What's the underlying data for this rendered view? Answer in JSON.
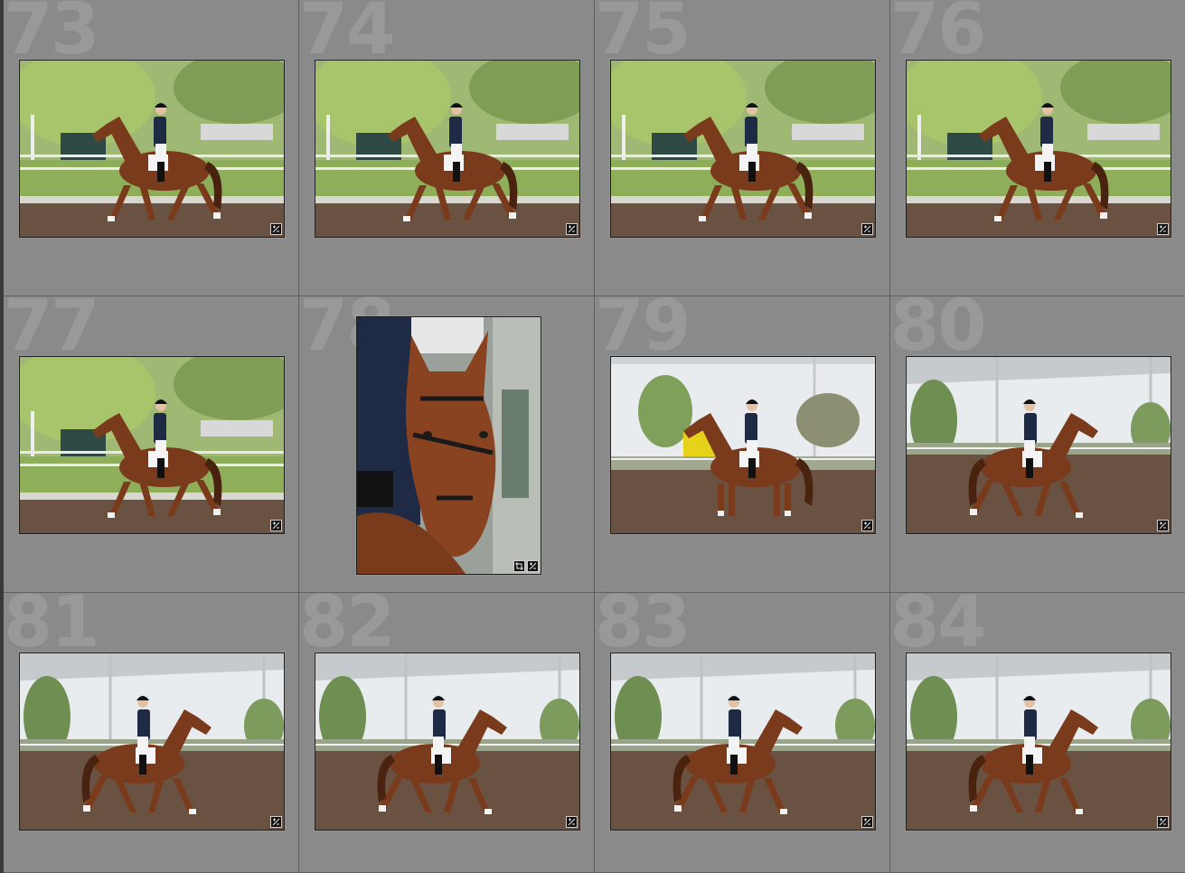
{
  "app": "Photo library grid view",
  "cells": [
    {
      "number": "73",
      "orientation": "landscape",
      "scene": "trees-left",
      "badges": [
        "develop-adjustments-icon"
      ]
    },
    {
      "number": "74",
      "orientation": "landscape",
      "scene": "trees-left",
      "badges": [
        "develop-adjustments-icon"
      ]
    },
    {
      "number": "75",
      "orientation": "landscape",
      "scene": "trees-left",
      "badges": [
        "develop-adjustments-icon"
      ]
    },
    {
      "number": "76",
      "orientation": "landscape",
      "scene": "trees-left",
      "badges": [
        "develop-adjustments-icon"
      ]
    },
    {
      "number": "77",
      "orientation": "landscape",
      "scene": "trees-left",
      "badges": [
        "develop-adjustments-icon"
      ]
    },
    {
      "number": "78",
      "orientation": "portrait",
      "scene": "closeup",
      "badges": [
        "crop-icon",
        "develop-adjustments-icon"
      ]
    },
    {
      "number": "79",
      "orientation": "landscape",
      "scene": "arena-standing",
      "badges": [
        "develop-adjustments-icon"
      ]
    },
    {
      "number": "80",
      "orientation": "landscape",
      "scene": "arena-right",
      "badges": [
        "develop-adjustments-icon"
      ]
    },
    {
      "number": "81",
      "orientation": "landscape",
      "scene": "arena-right",
      "badges": [
        "develop-adjustments-icon"
      ]
    },
    {
      "number": "82",
      "orientation": "landscape",
      "scene": "arena-right",
      "badges": [
        "develop-adjustments-icon"
      ]
    },
    {
      "number": "83",
      "orientation": "landscape",
      "scene": "arena-right",
      "badges": [
        "develop-adjustments-icon"
      ]
    },
    {
      "number": "84",
      "orientation": "landscape",
      "scene": "arena-right",
      "badges": [
        "develop-adjustments-icon"
      ]
    }
  ],
  "colors": {
    "cell_bg": "#8a8a8a",
    "border": "#5e5e5e",
    "horse": "#7a3a1c",
    "jacket": "#1f2a44",
    "arena_dirt": "#6a5242",
    "grass": "#8fae5a",
    "foliage": "#a9c56b",
    "sky": "#e9ecef"
  }
}
